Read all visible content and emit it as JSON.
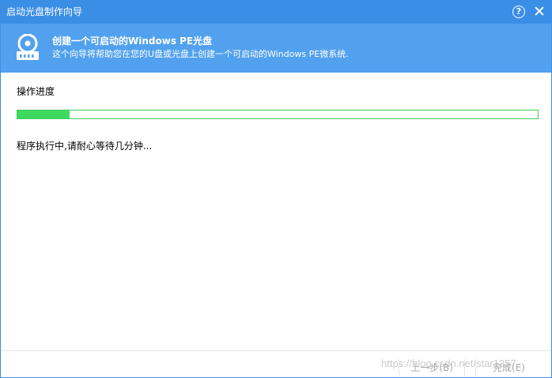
{
  "window": {
    "title": "启动光盘制作向导"
  },
  "titlebar": {
    "help_label": "?",
    "close_label": "✕"
  },
  "banner": {
    "icon": "disk-drive-icon",
    "title": "创建一个可启动的Windows PE光盘",
    "subtitle": "这个向导将帮助您在您的U盘或光盘上创建一个可启动的Windows PE微系统."
  },
  "content": {
    "section_label": "操作进度",
    "progress_percent": 10,
    "status_text": "程序执行中,请耐心等待几分钟..."
  },
  "footer": {
    "prev_label": "上一步(B)",
    "finish_label": "完成(E)"
  },
  "watermark": "https://blog.csdn.net/star1357",
  "colors": {
    "titlebar": "#3a8ee6",
    "banner": "#52a1ee",
    "progress": "#3fd95f"
  }
}
